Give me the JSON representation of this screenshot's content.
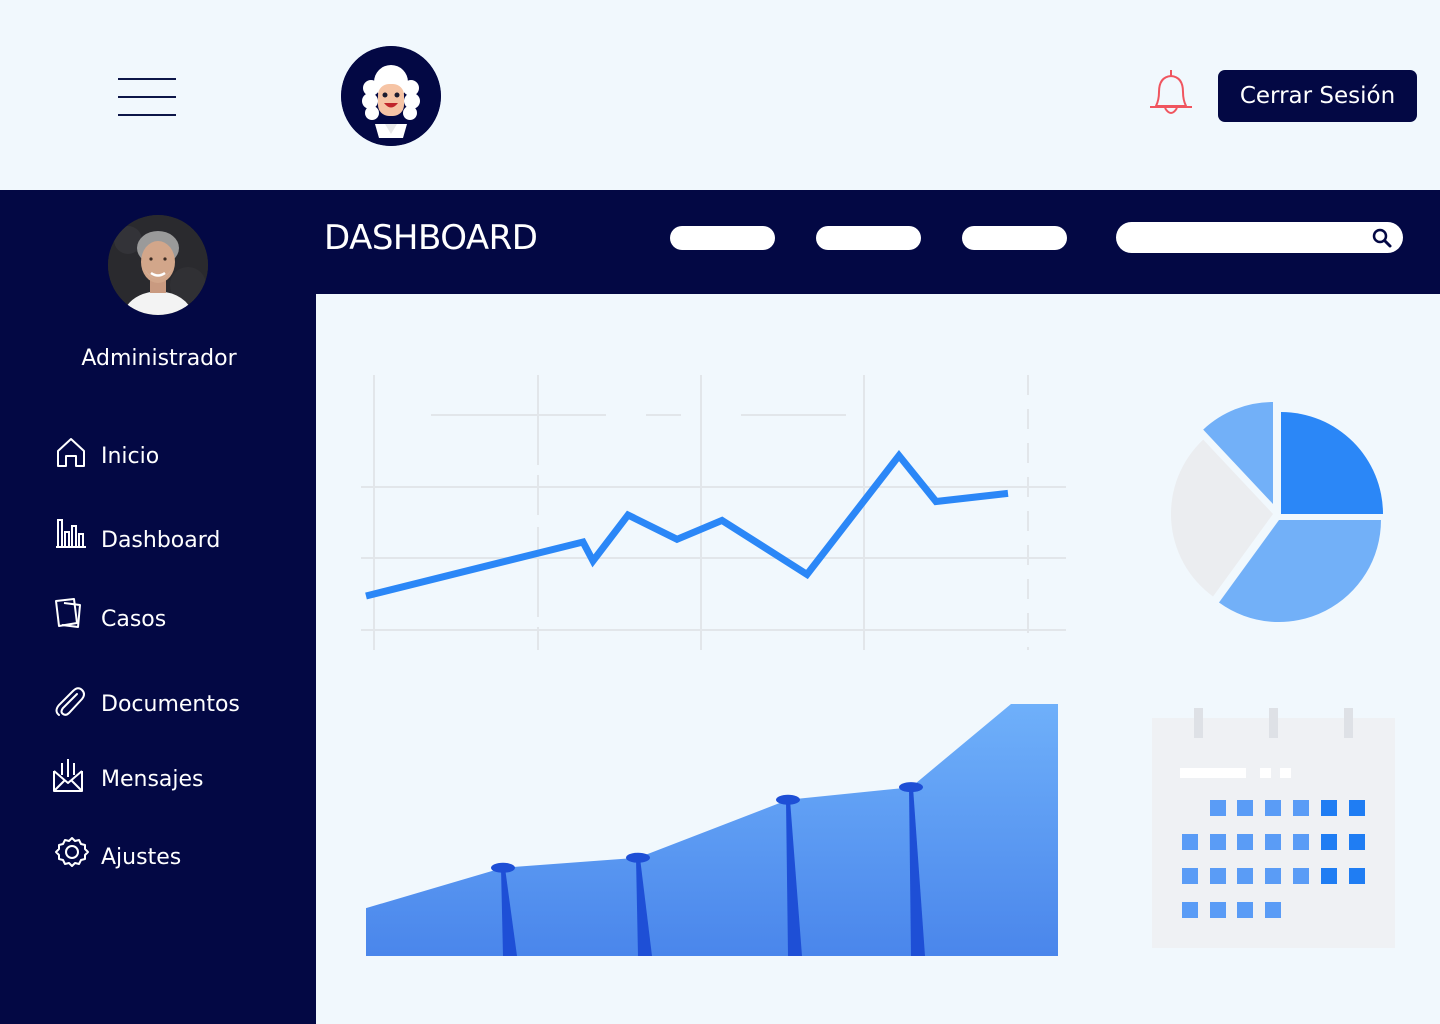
{
  "topbar": {
    "logout_label": "Cerrar Sesión"
  },
  "header": {
    "title": "DASHBOARD",
    "nav_pills": [
      "",
      "",
      ""
    ],
    "search": {
      "placeholder": "",
      "value": ""
    }
  },
  "sidebar": {
    "role": "Administrador",
    "items": [
      {
        "label": "Inicio",
        "icon": "home-icon"
      },
      {
        "label": "Dashboard",
        "icon": "bar-chart-icon"
      },
      {
        "label": "Casos",
        "icon": "cases-icon"
      },
      {
        "label": "Documentos",
        "icon": "paperclip-icon"
      },
      {
        "label": "Mensajes",
        "icon": "envelope-icon"
      },
      {
        "label": "Ajustes",
        "icon": "gear-icon"
      }
    ]
  },
  "colors": {
    "navy": "#030844",
    "background": "#f1f8fd",
    "accent_blue": "#2b87f7",
    "light_blue": "#72b0f8",
    "bell_red": "#f0555f"
  },
  "chart_data": [
    {
      "type": "line",
      "x": [
        0,
        1,
        2,
        3,
        4,
        5,
        6,
        7,
        8,
        9,
        10
      ],
      "values": [
        20,
        40,
        33,
        50,
        41,
        48,
        28,
        72,
        55,
        58
      ],
      "ylim": [
        0,
        100
      ],
      "grid": true
    },
    {
      "type": "pie",
      "values": [
        25,
        35,
        28,
        12
      ]
    },
    {
      "type": "area",
      "x": [
        0,
        1,
        2,
        3,
        4,
        5,
        6
      ],
      "values": [
        19,
        35,
        39,
        62,
        67,
        100,
        100
      ],
      "ylim": [
        0,
        100
      ]
    }
  ]
}
